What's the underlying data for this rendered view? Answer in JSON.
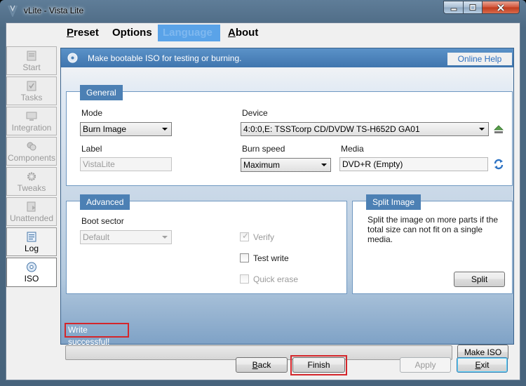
{
  "window": {
    "title": "vLite - Vista Lite"
  },
  "menu": {
    "preset": {
      "accel": "P",
      "rest": "reset"
    },
    "options": {
      "label": "Options"
    },
    "language": {
      "label": "Language"
    },
    "about": {
      "accel": "A",
      "rest": "bout"
    }
  },
  "sidebar": {
    "items": [
      {
        "label": "Start",
        "icon": "start-icon",
        "state": "disabled"
      },
      {
        "label": "Tasks",
        "icon": "tasks-icon",
        "state": "disabled"
      },
      {
        "label": "Integration",
        "icon": "integration-icon",
        "state": "disabled"
      },
      {
        "label": "Components",
        "icon": "components-icon",
        "state": "disabled"
      },
      {
        "label": "Tweaks",
        "icon": "gear-icon",
        "state": "disabled"
      },
      {
        "label": "Unattended",
        "icon": "unattended-icon",
        "state": "disabled"
      },
      {
        "label": "Log",
        "icon": "log-icon",
        "state": "enabled"
      },
      {
        "label": "ISO",
        "icon": "disc-icon",
        "state": "active"
      }
    ]
  },
  "header": {
    "text": "Make bootable ISO for testing or burning.",
    "help_link": "Online Help"
  },
  "general": {
    "title": "General",
    "mode_label": "Mode",
    "mode_value": "Burn Image",
    "device_label": "Device",
    "device_value": "4:0:0,E: TSSTcorp CD/DVDW TS-H652D GA01",
    "label_label": "Label",
    "label_value": "VistaLite",
    "burn_speed_label": "Burn speed",
    "burn_speed_value": "Maximum",
    "media_label": "Media",
    "media_value": "DVD+R (Empty)"
  },
  "advanced": {
    "title": "Advanced",
    "boot_sector_label": "Boot sector",
    "boot_sector_value": "Default",
    "verify_label": "Verify",
    "verify_checked": true,
    "test_write_label": "Test write",
    "test_write_checked": false,
    "quick_erase_label": "Quick erase",
    "quick_erase_checked": false
  },
  "split": {
    "title": "Split Image",
    "description": "Split the image on more parts if the total size can not fit on a single media.",
    "button": "Split"
  },
  "status": {
    "message": "Write successful!",
    "progress": 0
  },
  "actions": {
    "make_iso": "Make ISO",
    "back": {
      "accel": "B",
      "rest": "ack"
    },
    "finish": "Finish",
    "apply": "Apply",
    "exit": {
      "accel": "E",
      "rest": "xit"
    }
  },
  "colors": {
    "accent": "#4c80b4",
    "highlight_outline": "#d4262b",
    "link": "#2c6fbf"
  }
}
